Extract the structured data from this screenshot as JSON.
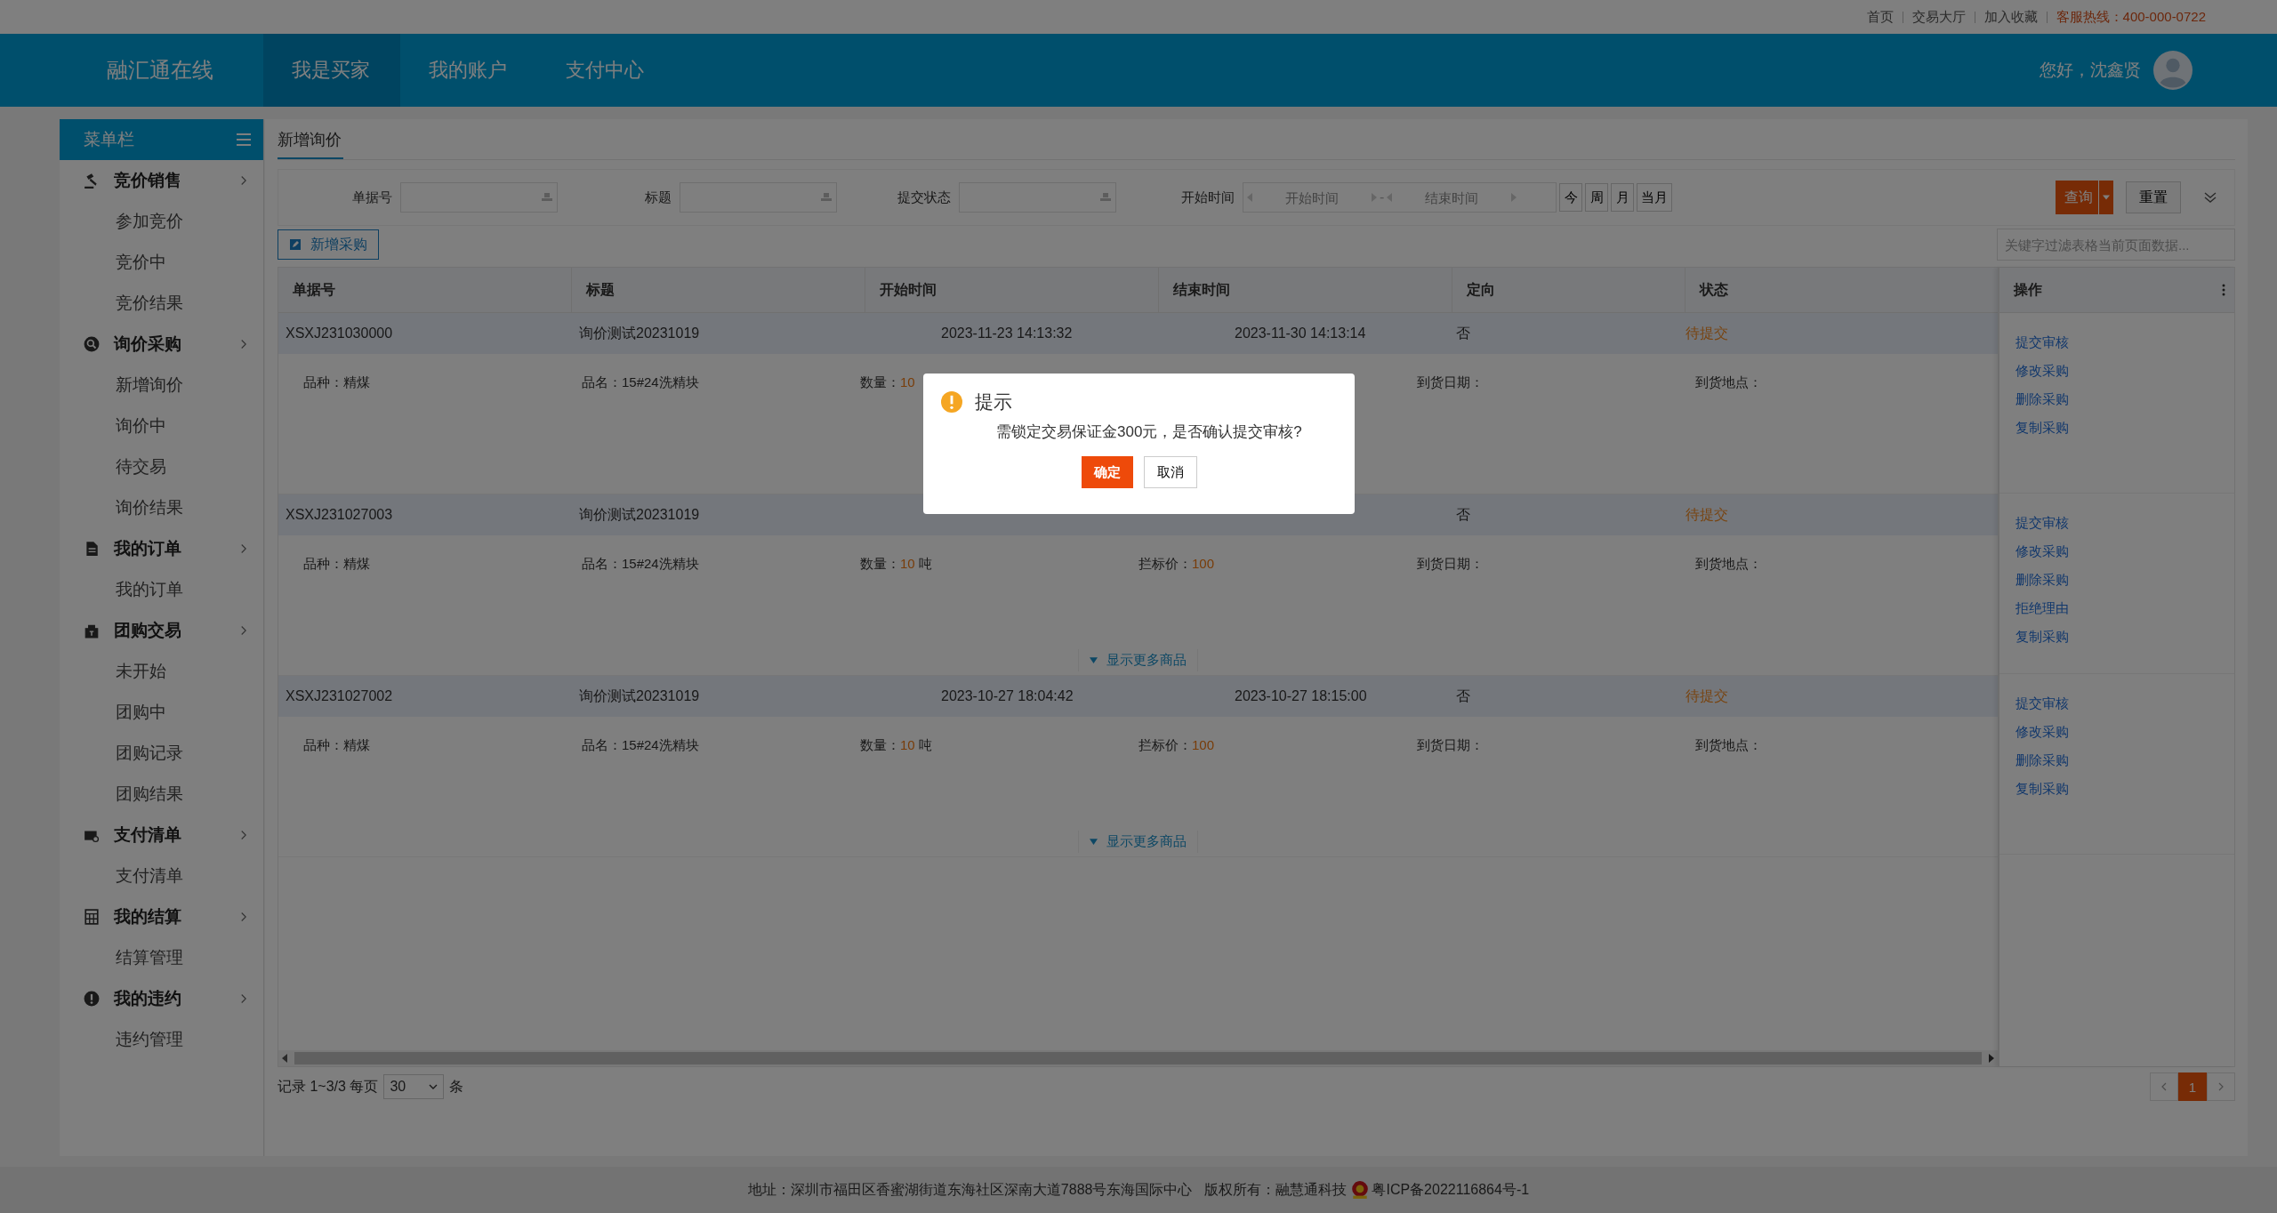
{
  "top_links": [
    "首页",
    "交易大厅",
    "加入收藏"
  ],
  "hotline": "客服热线：400-000-0722",
  "header": {
    "logo": "融汇通在线",
    "greeting": "您好，沈鑫贤",
    "nav": [
      {
        "label": "我是买家",
        "selected": true
      },
      {
        "label": "我的账户",
        "selected": false
      },
      {
        "label": "支付中心",
        "selected": false
      }
    ]
  },
  "sidebar": {
    "title": "菜单栏",
    "groups": [
      {
        "label": "竞价销售",
        "kind": "gavel",
        "children": [
          {
            "label": "参加竞价"
          },
          {
            "label": "竞价中"
          },
          {
            "label": "竞价结果"
          }
        ]
      },
      {
        "label": "询价采购",
        "kind": "search",
        "children": [
          {
            "label": "新增询价"
          },
          {
            "label": "询价中"
          },
          {
            "label": "待交易"
          },
          {
            "label": "询价结果"
          }
        ]
      },
      {
        "label": "我的订单",
        "kind": "doc",
        "children": [
          {
            "label": "我的订单"
          }
        ]
      },
      {
        "label": "团购交易",
        "kind": "bag",
        "children": [
          {
            "label": "未开始"
          },
          {
            "label": "团购中"
          },
          {
            "label": "团购记录"
          },
          {
            "label": "团购结果"
          }
        ]
      },
      {
        "label": "支付清单",
        "kind": "wallet",
        "children": [
          {
            "label": "支付清单"
          }
        ]
      },
      {
        "label": "我的结算",
        "kind": "calc",
        "children": [
          {
            "label": "结算管理"
          }
        ]
      },
      {
        "label": "我的违约",
        "kind": "alert",
        "children": [
          {
            "label": "违约管理"
          }
        ]
      }
    ]
  },
  "page_tab": "新增询价",
  "filters": {
    "fields": [
      {
        "label": "单据号"
      },
      {
        "label": "标题"
      },
      {
        "label": "提交状态"
      }
    ],
    "date": {
      "label": "开始时间",
      "start_placeholder": "开始时间",
      "separator": "-",
      "end_placeholder": "结束时间"
    },
    "quick": [
      "今",
      "周",
      "月",
      "当月"
    ],
    "query": "查询",
    "reset": "重置"
  },
  "add_button": "新增采购",
  "table_filter": {
    "placeholder": "关键字过滤表格当前页面数据..."
  },
  "table": {
    "columns": [
      "单据号",
      "标题",
      "开始时间",
      "结束时间",
      "定向",
      "状态"
    ],
    "actions_column": "操作",
    "rows": [
      {
        "id": "XSXJ231030000",
        "title": "询价测试20231019",
        "start": "2023-11-23 14:13:32",
        "end": "2023-11-30 14:13:14",
        "directed": "否",
        "status": "待提交",
        "details": [
          {
            "kind": "variety",
            "label": "品种：",
            "value": "精煤"
          },
          {
            "kind": "product",
            "label": "品名：",
            "value": "15#24洗精块"
          },
          {
            "kind": "quantity",
            "label": "数量：",
            "value": "10",
            "highlight": true
          },
          {
            "kind": "arrival_date",
            "label": "到货日期："
          },
          {
            "kind": "arrival_place",
            "label": "到货地点："
          }
        ],
        "actions": [
          "提交审核",
          "修改采购",
          "删除采购",
          "复制采购"
        ]
      },
      {
        "id": "XSXJ231027003",
        "title": "询价测试20231019",
        "directed": "否",
        "status": "待提交",
        "details": [
          {
            "kind": "variety",
            "label": "品种：",
            "value": "精煤"
          },
          {
            "kind": "product",
            "label": "品名：",
            "value": "15#24洗精块"
          },
          {
            "kind": "quantity",
            "label": "数量：",
            "value": "10",
            "highlight": true,
            "unit": "吨"
          },
          {
            "kind": "price",
            "label": "拦标价：",
            "value": "100",
            "highlight": true
          },
          {
            "kind": "arrival_date",
            "label": "到货日期："
          },
          {
            "kind": "arrival_place",
            "label": "到货地点："
          }
        ],
        "actions": [
          "提交审核",
          "修改采购",
          "删除采购",
          "拒绝理由",
          "复制采购"
        ],
        "show_more": "显示更多商品"
      },
      {
        "id": "XSXJ231027002",
        "title": "询价测试20231019",
        "start": "2023-10-27 18:04:42",
        "end": "2023-10-27 18:15:00",
        "directed": "否",
        "status": "待提交",
        "details": [
          {
            "kind": "variety",
            "label": "品种：",
            "value": "精煤"
          },
          {
            "kind": "product",
            "label": "品名：",
            "value": "15#24洗精块"
          },
          {
            "kind": "quantity",
            "label": "数量：",
            "value": "10",
            "highlight": true,
            "unit": "吨"
          },
          {
            "kind": "price",
            "label": "拦标价：",
            "value": "100",
            "highlight": true
          },
          {
            "kind": "arrival_date",
            "label": "到货日期："
          },
          {
            "kind": "arrival_place",
            "label": "到货地点："
          }
        ],
        "actions": [
          "提交审核",
          "修改采购",
          "删除采购",
          "复制采购"
        ],
        "show_more": "显示更多商品"
      }
    ]
  },
  "pager": {
    "summary": "记录 1~3/3 每页",
    "page_size": "30",
    "unit": "条",
    "pages": [
      {
        "label": "1",
        "selected": true
      }
    ]
  },
  "dialog": {
    "title": "提示",
    "message": "需锁定交易保证金300元，是否确认提交审核?",
    "ok": "确定",
    "cancel": "取消"
  },
  "footer": {
    "address": "地址：深圳市福田区香蜜湖街道东海社区深南大道7888号东海国际中心",
    "copyright": "版权所有：融慧通科技",
    "icp": "粤ICP备2022116864号-1"
  }
}
